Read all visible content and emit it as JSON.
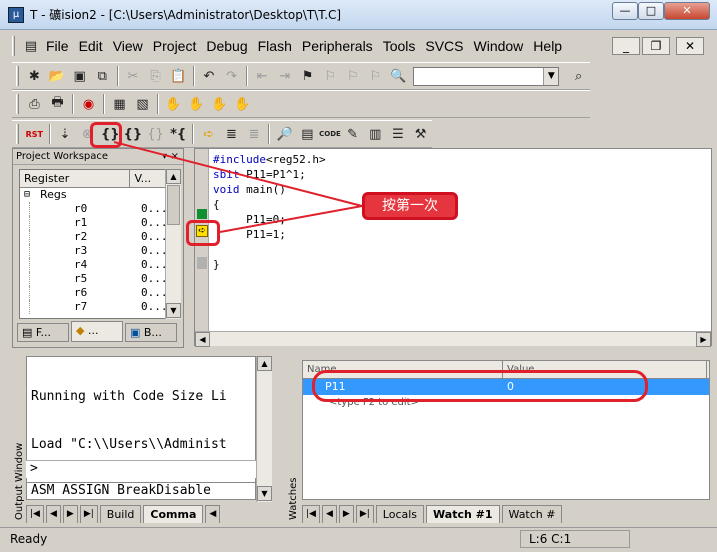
{
  "window": {
    "title": "T  - 礦ision2 - [C:\\Users\\Administrator\\Desktop\\T\\T.C]",
    "app_icon_text": "μ"
  },
  "menu": [
    "File",
    "Edit",
    "View",
    "Project",
    "Debug",
    "Flash",
    "Peripherals",
    "Tools",
    "SVCS",
    "Window",
    "Help"
  ],
  "toolbar": {
    "rst_label": "RST",
    "find_value": ""
  },
  "workspace": {
    "title": "Project Workspace",
    "columns": [
      "Register",
      "V..."
    ],
    "group": "Regs",
    "registers": [
      {
        "name": "r0",
        "value": "0..."
      },
      {
        "name": "r1",
        "value": "0..."
      },
      {
        "name": "r2",
        "value": "0..."
      },
      {
        "name": "r3",
        "value": "0..."
      },
      {
        "name": "r4",
        "value": "0..."
      },
      {
        "name": "r5",
        "value": "0..."
      },
      {
        "name": "r6",
        "value": "0..."
      },
      {
        "name": "r7",
        "value": "0..."
      }
    ],
    "tabs": [
      "F...",
      "...",
      "B..."
    ]
  },
  "editor": {
    "lines": [
      "#include<reg52.h>",
      "sbit P11=P1^1;",
      "void main()",
      "{",
      "     P11=0;",
      "     P11=1;",
      "",
      "}"
    ]
  },
  "output": {
    "lines": [
      "Running with Code Size Li",
      "Load \"C:\\\\Users\\\\Administ"
    ],
    "prompt": ">",
    "command": "ASM ASSIGN BreakDisable",
    "window_label": "Output Window",
    "tabs": [
      "Build",
      "Comma"
    ]
  },
  "watch": {
    "window_label": "Watches",
    "columns": [
      "Name",
      "Value"
    ],
    "rows": [
      {
        "name": "P11",
        "value": "0"
      }
    ],
    "hint": "<type F2 to edit>",
    "tabs": [
      "Locals",
      "Watch #1",
      "Watch #"
    ]
  },
  "status": {
    "left": "Ready",
    "right": "L:6 C:1"
  },
  "annotation": {
    "callout_text": "按第一次"
  },
  "colors": {
    "annotation_red": "#e0202a",
    "selection_blue": "#3399ff"
  }
}
